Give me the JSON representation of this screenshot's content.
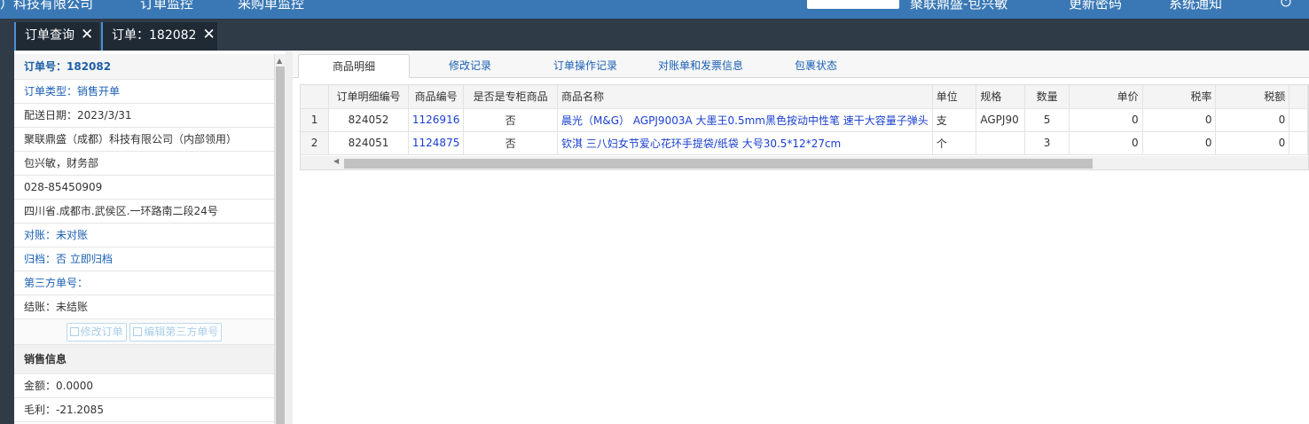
{
  "topbar": {
    "company": "）科技有限公司",
    "order_monitor": "订单监控",
    "purchase_monitor": "采购单监控",
    "user_info": "聚联鼎盛-包兴敏",
    "change_password": "更新密码",
    "messages": "系统通知",
    "right_icon": "power-icon"
  },
  "tabs": [
    {
      "label": "订单查询"
    },
    {
      "label": "订单：182082"
    }
  ],
  "left": {
    "order_no": "订单号：182082",
    "order_type": "订单类型：销售开单",
    "ship_date": "配送日期：2023/3/31",
    "customer": "聚联鼎盛（成都）科技有限公司（内部领用）",
    "contact": "包兴敏，财务部",
    "phone": "028-85450909",
    "address": "四川省.成都市.武侯区.一环路南二段24号",
    "reconcile": "对账：未对账",
    "archive": "归档：否 立即归档",
    "third_party": "第三方单号：",
    "settle": "结账：未结账",
    "btn_edit_order": "修改订单",
    "btn_edit_third": "编辑第三方单号",
    "sales_title": "销售信息",
    "amount": "金额：0.0000",
    "gross_profit": "毛利：-21.2085"
  },
  "subtabs": [
    {
      "label": "商品明细"
    },
    {
      "label": "修改记录"
    },
    {
      "label": "订单操作记录"
    },
    {
      "label": "对账单和发票信息"
    },
    {
      "label": "包裹状态"
    }
  ],
  "grid": {
    "headers": [
      "订单明细编号",
      "商品编号",
      "是否是专柜商品",
      "商品名称",
      "单位",
      "规格",
      "数量",
      "单价",
      "税率",
      "税额"
    ],
    "rows": [
      {
        "idx": "1",
        "detail_no": "824052",
        "product_no": "1126916",
        "counter": "否",
        "name": "晨光（M&G） AGPJ9003A 大墨王0.5mm黑色按动中性笔 速干大容量子弹头",
        "unit": "支",
        "spec": "AGPJ90",
        "qty": "5",
        "price": "0",
        "tax_rate": "0",
        "tax": "0"
      },
      {
        "idx": "2",
        "detail_no": "824051",
        "product_no": "1124875",
        "counter": "否",
        "name": "钦淇 三八妇女节爱心花环手提袋/纸袋 大号30.5*12*27cm",
        "unit": "个",
        "spec": "",
        "qty": "3",
        "price": "0",
        "tax_rate": "0",
        "tax": "0"
      }
    ]
  }
}
